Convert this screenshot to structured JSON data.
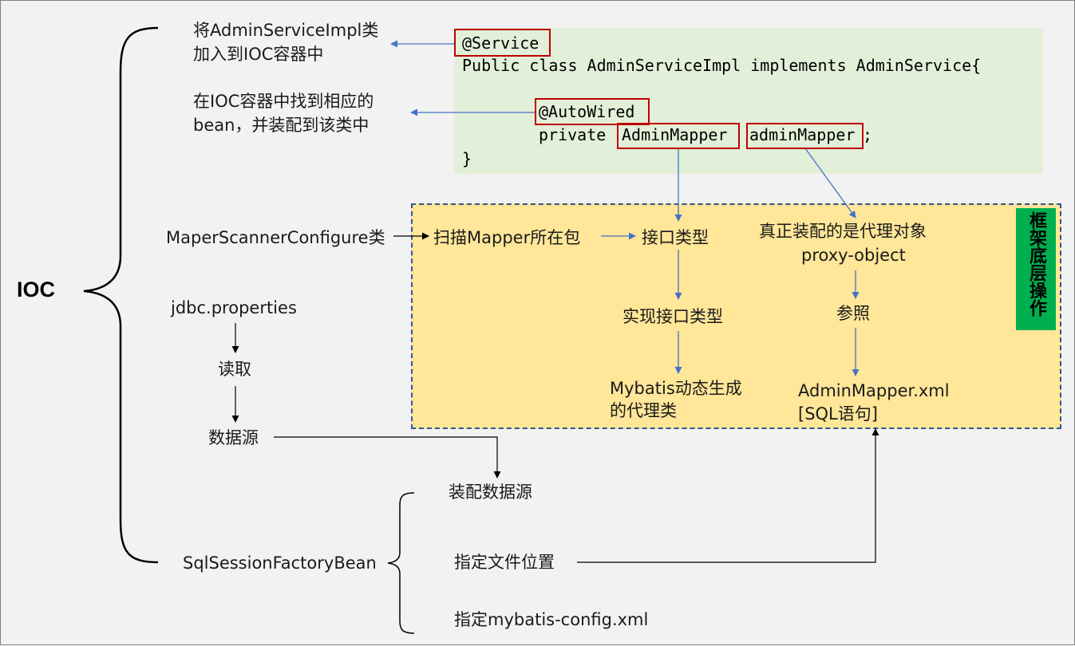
{
  "ioc": {
    "label": "IOC"
  },
  "annotations": {
    "add_to_ioc": [
      "将AdminServiceImpl类",
      "加入到IOC容器中"
    ],
    "find_bean": [
      "在IOC容器中找到相应的",
      "bean，并装配到该类中"
    ]
  },
  "code": {
    "line1": "@Service",
    "line2": "Public class AdminServiceImpl implements AdminService{",
    "line3_annot": "@AutoWired",
    "line4_kw": "private ",
    "line4_type": "AdminMapper",
    "line4_var": "adminMapper",
    "line4_end": ";",
    "line5": "}"
  },
  "left": {
    "mapper_scanner": "MaperScannerConfigure类",
    "jdbc_props": "jdbc.properties",
    "read": "读取",
    "datasource": "数据源",
    "session_factory": "SqlSessionFactoryBean"
  },
  "framework": {
    "tag": "框架底层操作",
    "scan_pkg": "扫描Mapper所在包",
    "interface_type": "接口类型",
    "impl_interface": "实现接口类型",
    "mybatis_gen": [
      "Mybatis动态生成",
      "的代理类"
    ],
    "real_inject": "真正装配的是代理对象",
    "proxy_object": "proxy-object",
    "reference": "参照",
    "mapper_xml": [
      "AdminMapper.xml",
      "[SQL语句]"
    ]
  },
  "session": {
    "assemble_ds": "装配数据源",
    "specify_file_location": "指定文件位置",
    "specify_config": "指定mybatis-config.xml"
  },
  "colors": {
    "code_bg": "#e2efd9",
    "framework_bg": "#ffe699",
    "framework_border": "#2f5597",
    "tag_bg": "#00b050",
    "highlight_border": "#c00000",
    "arrow_blue": "#4472c4",
    "arrow_black": "#000000"
  }
}
